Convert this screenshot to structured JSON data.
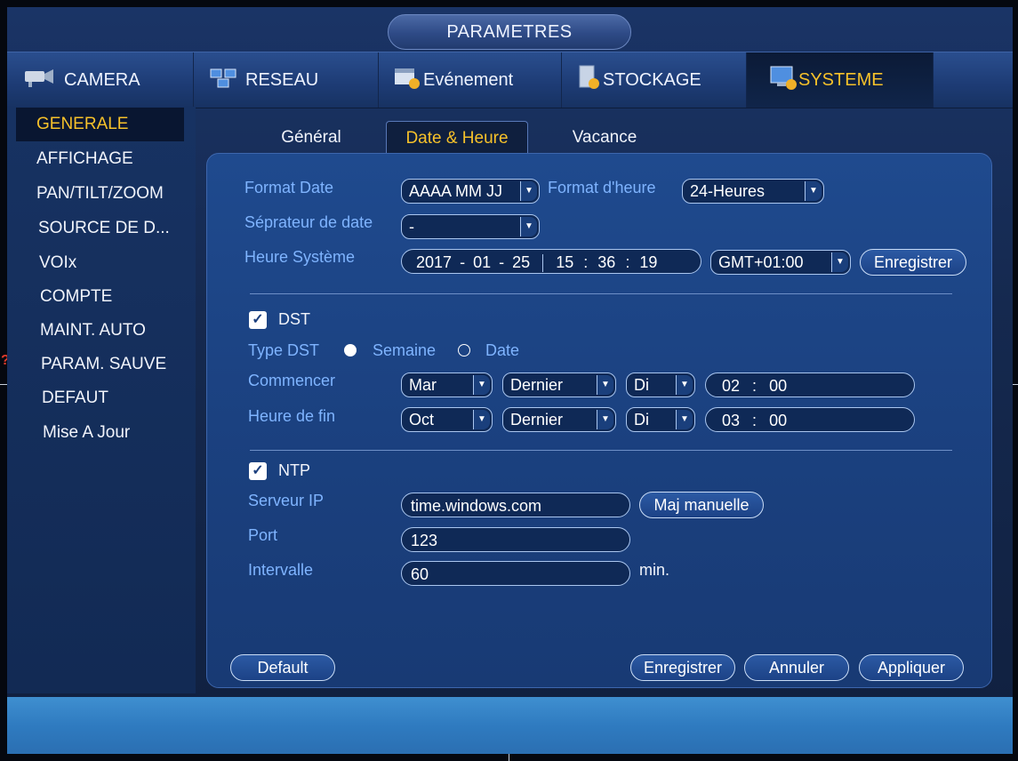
{
  "window": {
    "title": "PARAMETRES"
  },
  "topnav": [
    {
      "label": "CAMERA",
      "icon": "camera-icon"
    },
    {
      "label": "RESEAU",
      "icon": "network-icon"
    },
    {
      "label": "Evénement",
      "icon": "event-icon"
    },
    {
      "label": "STOCKAGE",
      "icon": "storage-icon"
    },
    {
      "label": "SYSTEME",
      "icon": "system-icon",
      "active": true
    }
  ],
  "sidebar": {
    "items": [
      "GENERALE",
      "AFFICHAGE",
      "PAN/TILT/ZOOM",
      "SOURCE DE D...",
      "VOIx",
      "COMPTE",
      "MAINT. AUTO",
      "PARAM. SAUVE",
      "DEFAUT",
      "Mise A Jour"
    ],
    "active_index": 0
  },
  "subtabs": {
    "items": [
      "Général",
      "Date & Heure",
      "Vacance"
    ],
    "active_index": 1
  },
  "datetime": {
    "format_date_label": "Format Date",
    "format_date_value": "AAAA MM JJ",
    "format_heure_label": "Format d'heure",
    "format_heure_value": "24-Heures",
    "separateur_label": "Séprateur de date",
    "separateur_value": "-",
    "heure_systeme_label": "Heure Système",
    "date_year": "2017",
    "date_month": "01",
    "date_day": "25",
    "date_sep": "-",
    "time_h": "15",
    "time_m": "36",
    "time_s": "19",
    "time_sep": ":",
    "timezone": "GMT+01:00",
    "enregistrer_label": "Enregistrer"
  },
  "dst": {
    "checkbox_label": "DST",
    "checked": true,
    "type_label": "Type DST",
    "option_semaine": "Semaine",
    "option_date": "Date",
    "selected": "Semaine",
    "start_label": "Commencer",
    "start_month": "Mar",
    "start_week": "Dernier",
    "start_day": "Di",
    "start_hour": "02",
    "start_min": "00",
    "end_label": "Heure de fin",
    "end_month": "Oct",
    "end_week": "Dernier",
    "end_day": "Di",
    "end_hour": "03",
    "end_min": "00",
    "time_sep": ":"
  },
  "ntp": {
    "checkbox_label": "NTP",
    "checked": true,
    "server_label": "Serveur IP",
    "server_value": "time.windows.com",
    "manual_update_label": "Maj manuelle",
    "port_label": "Port",
    "port_value": "123",
    "interval_label": "Intervalle",
    "interval_value": "60",
    "interval_unit": "min."
  },
  "footer": {
    "default_label": "Default",
    "save_label": "Enregistrer",
    "cancel_label": "Annuler",
    "apply_label": "Appliquer"
  },
  "overlay": {
    "warning_mark": "?"
  },
  "colors": {
    "accent": "#f6c12a",
    "label_blue": "#7fb4ff",
    "panel": "#1b4180"
  }
}
